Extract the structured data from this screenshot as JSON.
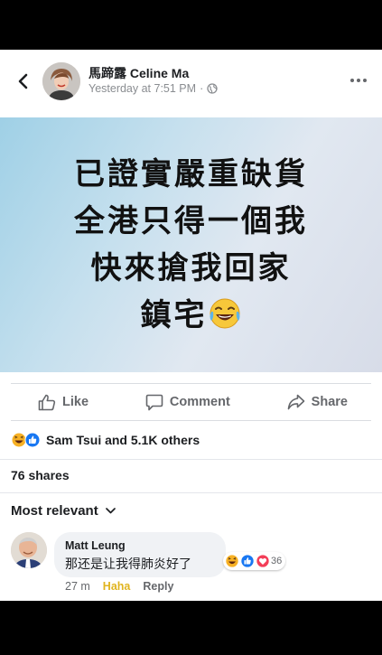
{
  "header": {
    "author": "馬蹄露 Celine Ma",
    "timestamp": "Yesterday at 7:51 PM",
    "separator": "·",
    "privacy_icon": "globe-icon"
  },
  "post": {
    "lines": [
      "已證實嚴重缺貨",
      "全港只得一個我",
      "快來搶我回家",
      "鎮宅"
    ],
    "emoji": "laughing-tears-emoji"
  },
  "actions": {
    "like": "Like",
    "comment": "Comment",
    "share": "Share"
  },
  "reactions": {
    "summary": "Sam Tsui and 5.1K others",
    "icons": [
      "haha",
      "like"
    ]
  },
  "shares": "76 shares",
  "sort": {
    "label": "Most relevant"
  },
  "comment": {
    "name": "Matt Leung",
    "text": "那还是让我得肺炎好了",
    "reaction_count": "36",
    "reaction_icons": [
      "haha",
      "like",
      "love"
    ],
    "time": "27 m",
    "haha_label": "Haha",
    "reply_label": "Reply"
  },
  "colors": {
    "page_bg": "#000000",
    "card_bg": "#ffffff",
    "meta_text": "#8a8d91",
    "action_text": "#65676b",
    "haha_yellow": "#f7b125",
    "like_blue": "#1877f2",
    "love_red": "#f33e58"
  }
}
